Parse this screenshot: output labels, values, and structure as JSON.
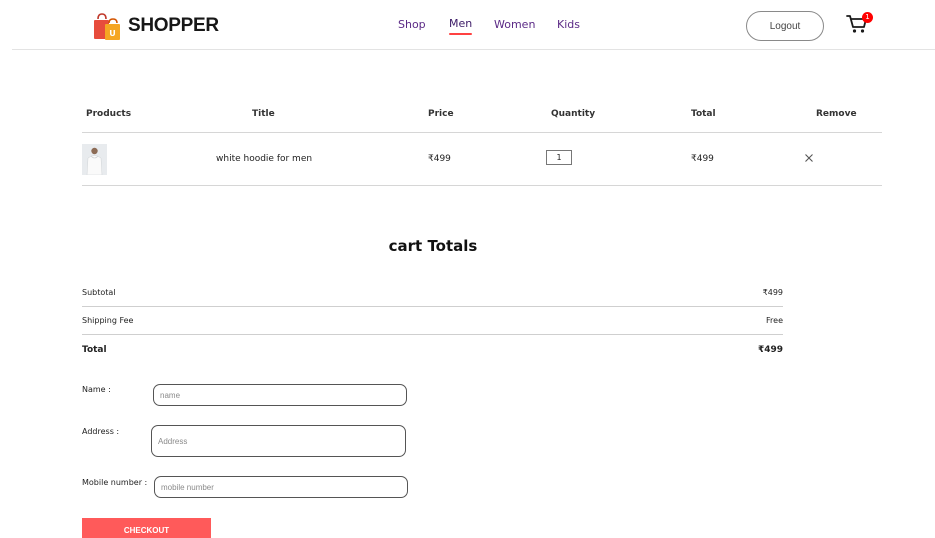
{
  "colors": {
    "accent": "#ff4141",
    "nav_text": "#5b2a86",
    "checkout_bg": "#ff5a5a",
    "badge": "#ff0000"
  },
  "brand": {
    "name": "SHOPPER",
    "icon": "shopping-bag-icon"
  },
  "nav": {
    "items": [
      {
        "label": "Shop"
      },
      {
        "label": "Men",
        "active": true
      },
      {
        "label": "Women"
      },
      {
        "label": "Kids"
      }
    ],
    "logout_label": "Logout",
    "cart_count": "1",
    "cart_icon": "cart-icon"
  },
  "cart_table": {
    "headers": [
      "Products",
      "Title",
      "Price",
      "Quantity",
      "Total",
      "Remove"
    ],
    "rows": [
      {
        "title": "white hoodie for men",
        "price": "₹499",
        "quantity": "1",
        "total": "₹499",
        "remove_icon": "close-icon"
      }
    ]
  },
  "totals": {
    "heading": "cart Totals",
    "subtotal_label": "Subtotal",
    "subtotal_value": "₹499",
    "shipping_label": "Shipping Fee",
    "shipping_value": "Free",
    "total_label": "Total",
    "total_value": "₹499"
  },
  "form": {
    "name_label": "Name :",
    "name_placeholder": "name",
    "address_label": "Address :",
    "address_placeholder": "Address",
    "mobile_label": "Mobile number :",
    "mobile_placeholder": "mobile number",
    "checkout_label": "CHECKOUT"
  }
}
